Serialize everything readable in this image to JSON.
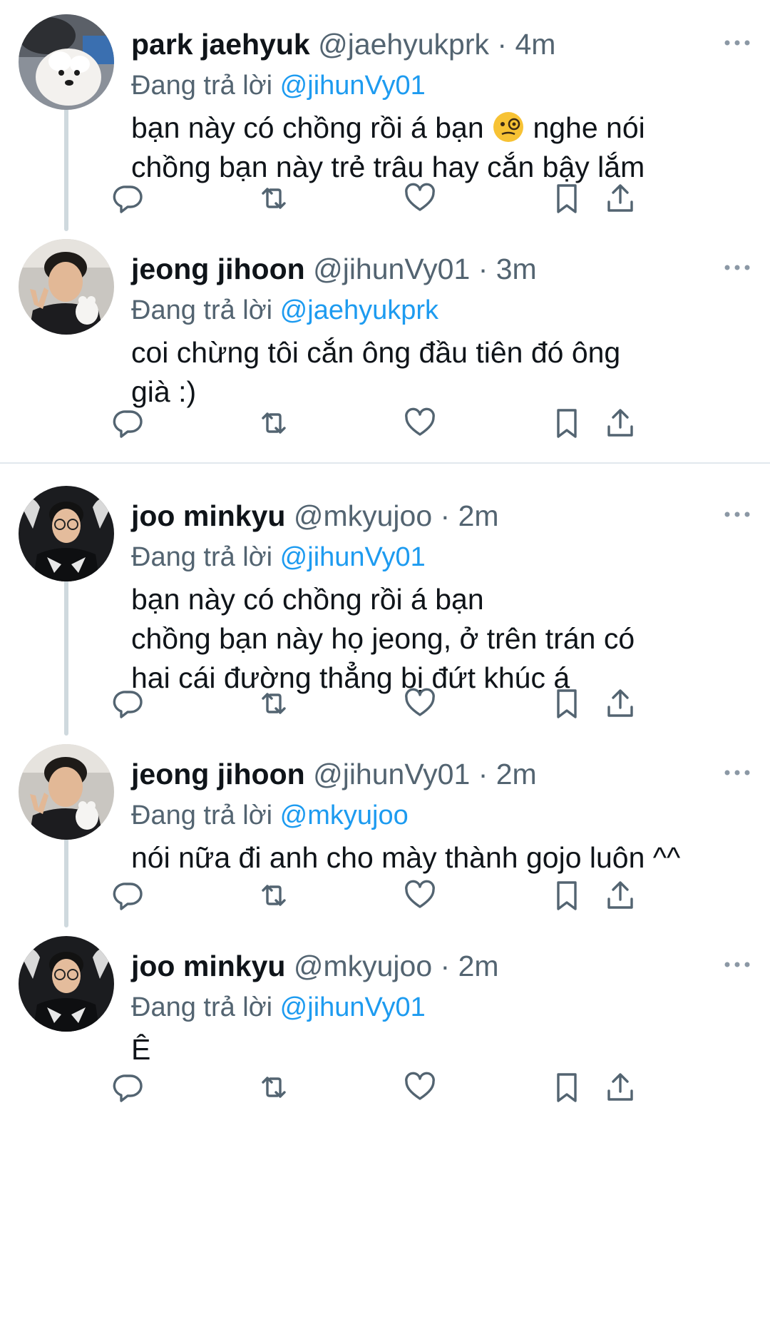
{
  "tweets": [
    {
      "name": "park jaehyuk",
      "handle": "@jaehyukprk",
      "dot": "·",
      "time": "4m",
      "reply_prefix": "Đang trả lời",
      "reply_to": "@jihunVy01",
      "lines": [
        "bạn này có chồng rồi á bạn",
        " nghe nói",
        "chồng bạn này trẻ trâu hay cắn bậy lắm"
      ],
      "avatar": "white-dog-photo"
    },
    {
      "name": "jeong jihoon",
      "handle": "@jihunVy01",
      "dot": "·",
      "time": "3m",
      "reply_prefix": "Đang trả lời",
      "reply_to": "@jaehyukprk",
      "lines": [
        "coi chừng tôi cắn ông đầu tiên đó ông",
        "già :)"
      ],
      "avatar": "person-peace-sign-photo"
    },
    {
      "name": "joo minkyu",
      "handle": "@mkyujoo",
      "dot": "·",
      "time": "2m",
      "reply_prefix": "Đang trả lời",
      "reply_to": "@jihunVy01",
      "lines": [
        "bạn này có chồng rồi á bạn",
        "chồng bạn này họ jeong, ở trên trán có",
        "hai cái đường thẳng bị đứt khúc á"
      ],
      "avatar": "person-glasses-photo"
    },
    {
      "name": "jeong jihoon",
      "handle": "@jihunVy01",
      "dot": "·",
      "time": "2m",
      "reply_prefix": "Đang trả lời",
      "reply_to": "@mkyujoo",
      "lines": [
        "nói nữa đi anh cho mày thành gojo luôn ^^"
      ],
      "avatar": "person-peace-sign-photo"
    },
    {
      "name": "joo minkyu",
      "handle": "@mkyujoo",
      "dot": "·",
      "time": "2m",
      "reply_prefix": "Đang trả lời",
      "reply_to": "@jihunVy01",
      "lines": [
        "Ê"
      ],
      "avatar": "person-glasses-photo"
    }
  ],
  "icons": {
    "reply": "reply-icon",
    "retweet": "retweet-icon",
    "like": "heart-icon",
    "bookmark": "bookmark-icon",
    "share": "share-icon",
    "more": "more-icon",
    "emoji": "face-with-monocle-icon"
  },
  "colors": {
    "text": "#0f1419",
    "secondary": "#536471",
    "mention": "#1d9bf0",
    "thread_line": "#cfd9de",
    "divider": "#e1e8ed"
  }
}
